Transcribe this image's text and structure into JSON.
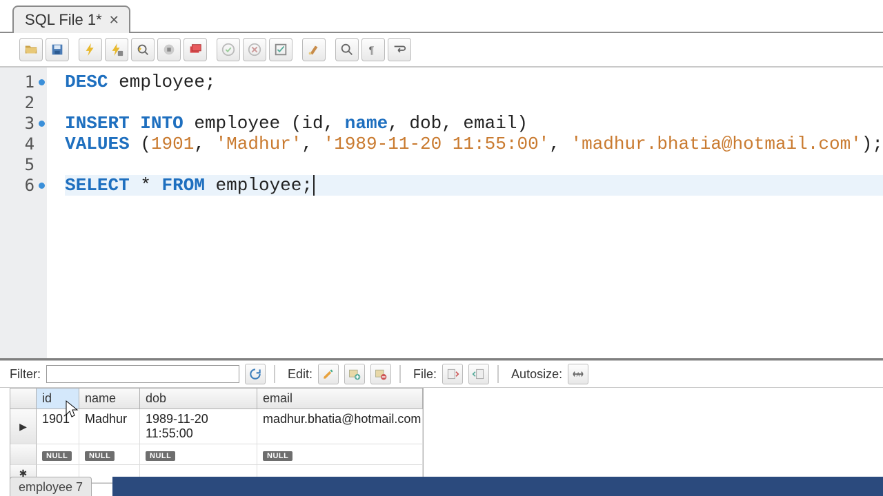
{
  "tab": {
    "title": "SQL File 1*"
  },
  "editor": {
    "lines": [
      {
        "n": "1",
        "marked": true,
        "tokens": [
          [
            "kw",
            "DESC"
          ],
          [
            "",
            " employee;"
          ]
        ]
      },
      {
        "n": "2",
        "marked": false,
        "tokens": []
      },
      {
        "n": "3",
        "marked": true,
        "tokens": [
          [
            "kw",
            "INSERT INTO"
          ],
          [
            "",
            " employee (id, "
          ],
          [
            "kw",
            "name"
          ],
          [
            "",
            ", dob, email)"
          ]
        ]
      },
      {
        "n": "4",
        "marked": false,
        "tokens": [
          [
            "kw",
            "VALUES"
          ],
          [
            "",
            " ("
          ],
          [
            "num",
            "1901"
          ],
          [
            "",
            ", "
          ],
          [
            "str",
            "'Madhur'"
          ],
          [
            "",
            ", "
          ],
          [
            "str",
            "'1989-11-20 11:55:00'"
          ],
          [
            "",
            ", "
          ],
          [
            "str",
            "'madhur.bhatia@hotmail.com'"
          ],
          [
            "",
            ");"
          ]
        ]
      },
      {
        "n": "5",
        "marked": false,
        "tokens": []
      },
      {
        "n": "6",
        "marked": true,
        "active": true,
        "tokens": [
          [
            "kw",
            "SELECT"
          ],
          [
            "",
            " * "
          ],
          [
            "kw",
            "FROM"
          ],
          [
            "",
            " employee;"
          ]
        ]
      }
    ]
  },
  "results": {
    "filter_label": "Filter:",
    "filter_value": "",
    "edit_label": "Edit:",
    "file_label": "File:",
    "autosize_label": "Autosize:",
    "columns": [
      "id",
      "name",
      "dob",
      "email"
    ],
    "rows": [
      {
        "selector": "▶",
        "cells": [
          "1901",
          "Madhur",
          "1989-11-20 11:55:00",
          "madhur.bhatia@hotmail.com"
        ]
      },
      {
        "selector": "",
        "cells": [
          "NULL",
          "NULL",
          "NULL",
          "NULL"
        ],
        "null_row": true
      },
      {
        "selector": "✱",
        "cells": [
          "",
          "",
          "",
          ""
        ],
        "empty": true
      }
    ]
  },
  "status": {
    "tab": "employee 7"
  },
  "icons": {
    "open": "open",
    "save": "save",
    "exec": "execute",
    "exec_step": "execute-step",
    "explain": "explain",
    "stop": "stop",
    "stop_red": "stop-all",
    "commit": "commit",
    "rollback": "rollback",
    "snippet": "snippet",
    "beautify": "beautify",
    "find": "find",
    "invisible": "toggle-invisible",
    "wrap": "wrap"
  }
}
